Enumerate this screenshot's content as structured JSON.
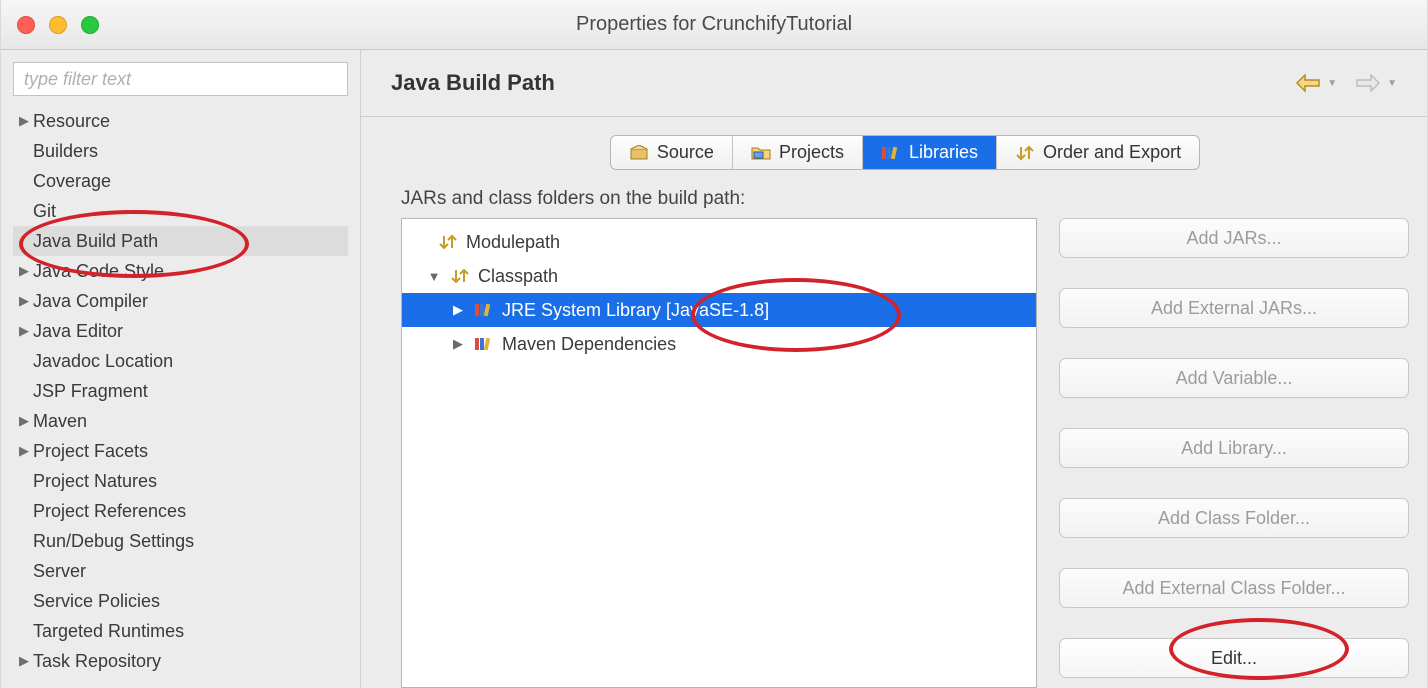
{
  "window": {
    "title": "Properties for CrunchifyTutorial"
  },
  "filter": {
    "placeholder": "type filter text"
  },
  "sidebar": {
    "items": [
      {
        "label": "Resource",
        "expandable": true
      },
      {
        "label": "Builders",
        "expandable": false
      },
      {
        "label": "Coverage",
        "expandable": false
      },
      {
        "label": "Git",
        "expandable": false
      },
      {
        "label": "Java Build Path",
        "expandable": false,
        "selected": true
      },
      {
        "label": "Java Code Style",
        "expandable": true
      },
      {
        "label": "Java Compiler",
        "expandable": true
      },
      {
        "label": "Java Editor",
        "expandable": true
      },
      {
        "label": "Javadoc Location",
        "expandable": false
      },
      {
        "label": "JSP Fragment",
        "expandable": false
      },
      {
        "label": "Maven",
        "expandable": true
      },
      {
        "label": "Project Facets",
        "expandable": true
      },
      {
        "label": "Project Natures",
        "expandable": false
      },
      {
        "label": "Project References",
        "expandable": false
      },
      {
        "label": "Run/Debug Settings",
        "expandable": false
      },
      {
        "label": "Server",
        "expandable": false
      },
      {
        "label": "Service Policies",
        "expandable": false
      },
      {
        "label": "Targeted Runtimes",
        "expandable": false
      },
      {
        "label": "Task Repository",
        "expandable": true
      }
    ]
  },
  "header": {
    "title": "Java Build Path"
  },
  "tabs": [
    {
      "label": "Source",
      "icon": "package-icon"
    },
    {
      "label": "Projects",
      "icon": "folder-icon"
    },
    {
      "label": "Libraries",
      "icon": "library-icon",
      "active": true
    },
    {
      "label": "Order and Export",
      "icon": "order-icon"
    }
  ],
  "subtitle": "JARs and class folders on the build path:",
  "tree": {
    "modulepath": {
      "label": "Modulepath"
    },
    "classpath": {
      "label": "Classpath"
    },
    "jre": {
      "label": "JRE System Library [JavaSE-1.8]"
    },
    "maven": {
      "label": "Maven Dependencies"
    }
  },
  "buttons": {
    "addJars": "Add JARs...",
    "addExtJars": "Add External JARs...",
    "addVar": "Add Variable...",
    "addLib": "Add Library...",
    "addClassFolder": "Add Class Folder...",
    "addExtClassFolder": "Add External Class Folder...",
    "edit": "Edit..."
  }
}
